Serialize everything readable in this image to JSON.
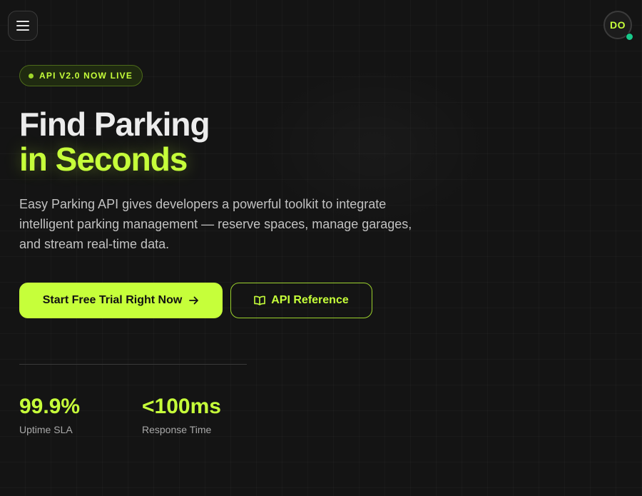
{
  "header": {
    "menu_icon": "hamburger-menu-icon",
    "avatar_initials": "DO",
    "avatar_status_color": "#18c98a"
  },
  "hero": {
    "badge": "API V2.0 NOW LIVE",
    "title_line1": "Find Parking",
    "title_line2": "in Seconds",
    "description": "Easy Parking API gives developers a powerful toolkit to integrate intelligent parking management — reserve spaces, manage garages, and stream real-time data.",
    "primary_cta": "Start Free Trial Right Now",
    "primary_cta_icon": "arrow-right-icon",
    "secondary_cta": "API Reference",
    "secondary_cta_icon": "book-open-icon"
  },
  "stats": [
    {
      "value": "99.9%",
      "label": "Uptime SLA"
    },
    {
      "value": "<100ms",
      "label": "Response Time"
    }
  ],
  "colors": {
    "accent": "#c6ff3a",
    "background": "#141414",
    "text": "#ececec",
    "muted_text": "#c2c2c2"
  }
}
